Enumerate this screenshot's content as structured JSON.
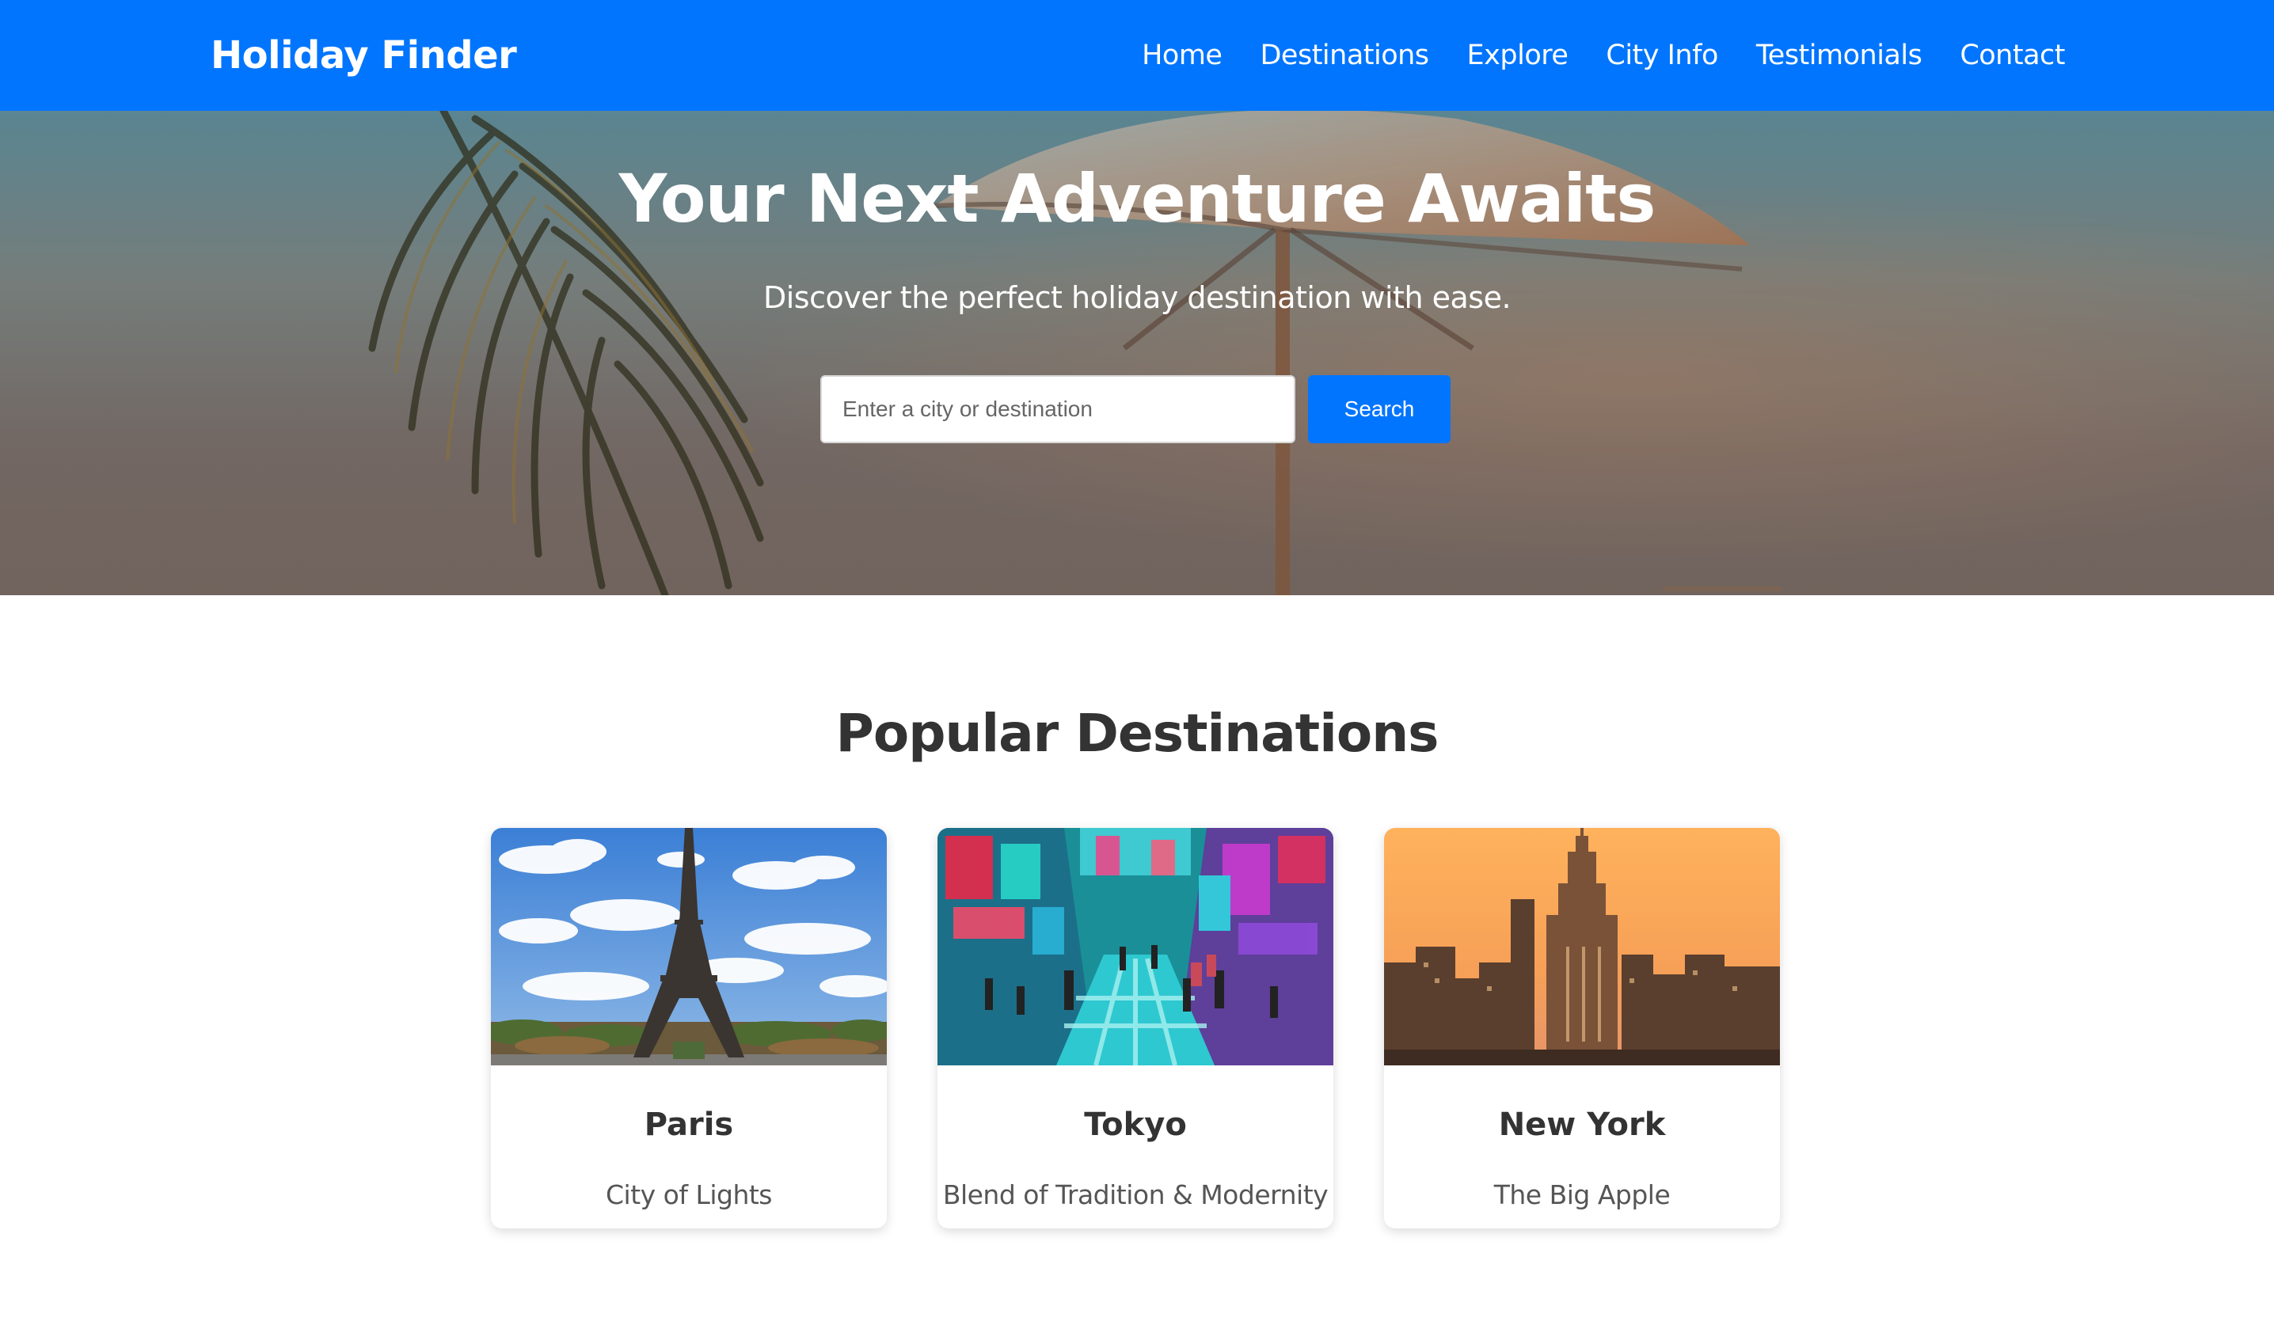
{
  "navbar": {
    "brand": "Holiday Finder",
    "links": [
      "Home",
      "Destinations",
      "Explore",
      "City Info",
      "Testimonials",
      "Contact"
    ],
    "background_color": "#0275fe"
  },
  "hero": {
    "title": "Your Next Adventure Awaits",
    "subtitle": "Discover the perfect holiday destination with ease.",
    "search_placeholder": "Enter a city or destination",
    "search_value": "",
    "search_button": "Search"
  },
  "popular": {
    "title": "Popular Destinations",
    "cards": [
      {
        "name": "Paris",
        "description": "City of Lights",
        "image": "eiffel-tower-photo"
      },
      {
        "name": "Tokyo",
        "description": "Blend of Tradition & Modernity",
        "image": "tokyo-street-photo"
      },
      {
        "name": "New York",
        "description": "The Big Apple",
        "image": "empire-state-skyline-photo"
      }
    ]
  }
}
